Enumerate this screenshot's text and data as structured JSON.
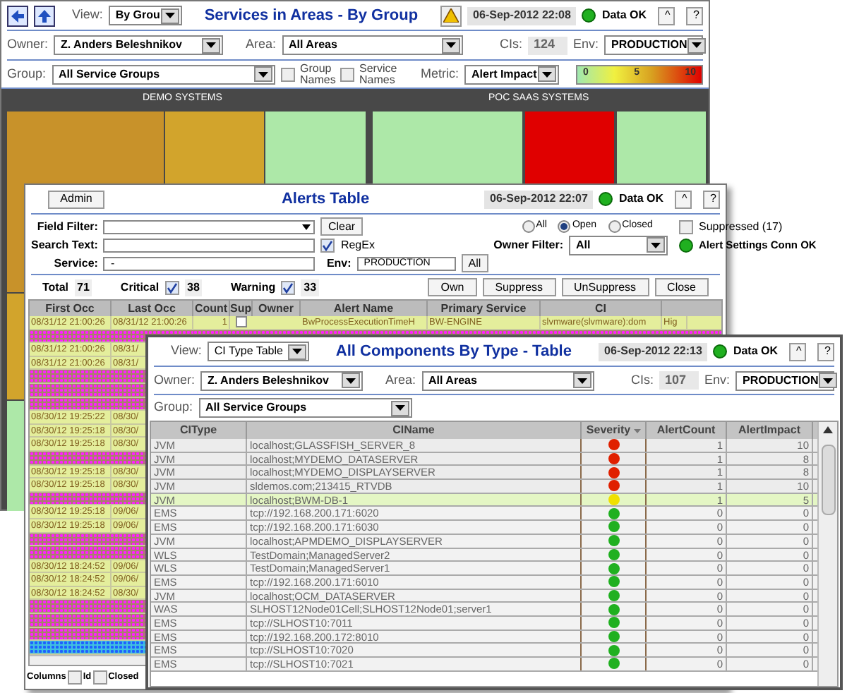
{
  "services_window": {
    "view": {
      "label": "View:",
      "value": "By Grou"
    },
    "title": "Services in Areas - By Group",
    "timestamp": "06-Sep-2012 22:08",
    "status": "Data OK",
    "buttons": [
      "^",
      "?"
    ],
    "owner": {
      "label": "Owner:",
      "value": "Z. Anders Beleshnikov"
    },
    "area": {
      "label": "Area:",
      "value": "All Areas"
    },
    "cis": {
      "label": "CIs:",
      "value": "124"
    },
    "env": {
      "label": "Env:",
      "value": "PRODUCTION"
    },
    "group": {
      "label": "Group:",
      "value": "All Service Groups"
    },
    "group_names": {
      "label": "Group Names",
      "checked": false
    },
    "service_names": {
      "label": "Service Names",
      "checked": false
    },
    "metric": {
      "label": "Metric:",
      "value": "Alert Impact"
    },
    "legend": [
      "0",
      "5",
      "10"
    ],
    "groups": [
      "DEMO SYSTEMS",
      "POC SAAS SYSTEMS"
    ],
    "tiles": [
      {
        "color": "#c8922a"
      },
      {
        "color": "#d2a42c"
      },
      {
        "color": "#ade8a8"
      },
      {
        "color": "#ade8a8"
      },
      {
        "color": "#e00000"
      },
      {
        "color": "#ade8a8"
      },
      {
        "color": "#d2a42c"
      },
      {
        "color": "#ade8a8"
      }
    ]
  },
  "alerts_window": {
    "admin": "Admin",
    "title": "Alerts Table",
    "timestamp": "06-Sep-2012 22:07",
    "status": "Data OK",
    "buttons": [
      "^",
      "?"
    ],
    "field_filter": {
      "label": "Field Filter:"
    },
    "clear": "Clear",
    "radios": [
      {
        "label": "All",
        "selected": false
      },
      {
        "label": "Open",
        "selected": true
      },
      {
        "label": "Closed",
        "selected": false
      }
    ],
    "suppressed": {
      "label": "Suppressed (17)",
      "checked": false
    },
    "search_text": {
      "label": "Search Text:"
    },
    "regex": {
      "label": "RegEx",
      "checked": true
    },
    "owner_filter": {
      "label": "Owner Filter:",
      "value": "All"
    },
    "conn_status": "Alert Settings Conn OK",
    "service": {
      "label": "Service:",
      "value": "-"
    },
    "env": {
      "label": "Env:",
      "value": "PRODUCTION"
    },
    "env_all": "All",
    "total": {
      "label": "Total",
      "value": "71"
    },
    "critical": {
      "label": "Critical",
      "checked": true,
      "value": "38"
    },
    "warning": {
      "label": "Warning",
      "checked": true,
      "value": "33"
    },
    "actions": [
      "Own",
      "Suppress",
      "UnSuppress",
      "Close"
    ],
    "columns": [
      "First Occ",
      "Last Occ",
      "Count",
      "Sup",
      "Owner",
      "Alert Name",
      "Primary Service",
      "CI"
    ],
    "rows": [
      {
        "kind": "warning",
        "selected": false,
        "first_occ": "08/31/12 21:00:26",
        "last_occ": "08/31/12 21:00:26",
        "count": "1",
        "suppressed": false,
        "alert_name": "BwProcessExecutionTimeH",
        "primary_service": "BW-ENGINE",
        "ci": "slvmware(slvmware):dom",
        "column_9": "Hig"
      },
      {
        "kind": "critical",
        "selected": false
      },
      {
        "kind": "warning",
        "selected": false,
        "first_occ": "08/31/12 21:00:26",
        "last_occ": "08/31/"
      },
      {
        "kind": "warning",
        "selected": false,
        "first_occ": "08/31/12 21:00:26",
        "last_occ": "08/31/"
      },
      {
        "kind": "critical",
        "selected": false
      },
      {
        "kind": "critical",
        "selected": false
      },
      {
        "kind": "critical",
        "selected": false
      },
      {
        "kind": "warning",
        "selected": false,
        "first_occ": "08/30/12 19:25:22",
        "last_occ": "08/30/"
      },
      {
        "kind": "warning",
        "selected": false,
        "first_occ": "08/30/12 19:25:18",
        "last_occ": "08/30/"
      },
      {
        "kind": "warning",
        "selected": false,
        "first_occ": "08/30/12 19:25:18",
        "last_occ": "08/30/"
      },
      {
        "kind": "critical",
        "selected": false
      },
      {
        "kind": "warning",
        "selected": false,
        "first_occ": "08/30/12 19:25:18",
        "last_occ": "08/30/"
      },
      {
        "kind": "warning",
        "selected": false,
        "first_occ": "08/30/12 19:25:18",
        "last_occ": "08/30/"
      },
      {
        "kind": "critical",
        "selected": false
      },
      {
        "kind": "warning",
        "selected": false,
        "first_occ": "08/30/12 19:25:18",
        "last_occ": "09/06/"
      },
      {
        "kind": "warning",
        "selected": false,
        "first_occ": "08/30/12 19:25:18",
        "last_occ": "09/06/"
      },
      {
        "kind": "critical",
        "selected": false
      },
      {
        "kind": "critical",
        "selected": false
      },
      {
        "kind": "warning",
        "selected": false,
        "first_occ": "08/30/12 18:24:52",
        "last_occ": "09/06/"
      },
      {
        "kind": "warning",
        "selected": false,
        "first_occ": "08/30/12 18:24:52",
        "last_occ": "09/06/"
      },
      {
        "kind": "warning",
        "selected": false,
        "first_occ": "08/30/12 18:24:52",
        "last_occ": "08/30/"
      },
      {
        "kind": "critical",
        "selected": false
      },
      {
        "kind": "critical",
        "selected": false
      },
      {
        "kind": "critical",
        "selected": false
      },
      {
        "kind": "critical",
        "selected": true
      }
    ],
    "footer": {
      "label": "Columns",
      "options": [
        {
          "label": "Id",
          "checked": false
        },
        {
          "label": "Closed",
          "checked": false
        }
      ]
    }
  },
  "components_window": {
    "view": {
      "label": "View:",
      "value": "CI Type Table"
    },
    "title": "All Components By Type - Table",
    "timestamp": "06-Sep-2012 22:13",
    "status": "Data OK",
    "buttons": [
      "^",
      "?"
    ],
    "owner": {
      "label": "Owner:",
      "value": "Z. Anders Beleshnikov"
    },
    "area": {
      "label": "Area:",
      "value": "All Areas"
    },
    "cis": {
      "label": "CIs:",
      "value": "107"
    },
    "env": {
      "label": "Env:",
      "value": "PRODUCTION"
    },
    "group": {
      "label": "Group:",
      "value": "All Service Groups"
    },
    "columns": [
      "CIType",
      "CIName",
      "Severity",
      "AlertCount",
      "AlertImpact"
    ],
    "rows": [
      {
        "ci_type": "JVM",
        "ci_name": "localhost;GLASSFISH_SERVER_8",
        "color": "#e02000",
        "alert_count": "1",
        "alert_impact": "10"
      },
      {
        "ci_type": "JVM",
        "ci_name": "localhost;MYDEMO_DATASERVER",
        "color": "#e02000",
        "alert_count": "1",
        "alert_impact": "8"
      },
      {
        "ci_type": "JVM",
        "ci_name": "localhost;MYDEMO_DISPLAYSERVER",
        "color": "#e02000",
        "alert_count": "1",
        "alert_impact": "8"
      },
      {
        "ci_type": "JVM",
        "ci_name": "sldemos.com;213415_RTVDB",
        "color": "#e02000",
        "alert_count": "1",
        "alert_impact": "10"
      },
      {
        "ci_type": "JVM",
        "ci_name": "localhost;BWM-DB-1",
        "color": "#f0e000",
        "alert_count": "1",
        "alert_impact": "5"
      },
      {
        "ci_type": "EMS",
        "ci_name": "tcp://192.168.200.171:6020",
        "color": "#20b020",
        "alert_count": "0",
        "alert_impact": "0"
      },
      {
        "ci_type": "EMS",
        "ci_name": "tcp://192.168.200.171:6030",
        "color": "#20b020",
        "alert_count": "0",
        "alert_impact": "0"
      },
      {
        "ci_type": "JVM",
        "ci_name": "localhost;APMDEMO_DISPLAYSERVER",
        "color": "#20b020",
        "alert_count": "0",
        "alert_impact": "0"
      },
      {
        "ci_type": "WLS",
        "ci_name": "TestDomain;ManagedServer2",
        "color": "#20b020",
        "alert_count": "0",
        "alert_impact": "0"
      },
      {
        "ci_type": "WLS",
        "ci_name": "TestDomain;ManagedServer1",
        "color": "#20b020",
        "alert_count": "0",
        "alert_impact": "0"
      },
      {
        "ci_type": "EMS",
        "ci_name": "tcp://192.168.200.171:6010",
        "color": "#20b020",
        "alert_count": "0",
        "alert_impact": "0"
      },
      {
        "ci_type": "JVM",
        "ci_name": "localhost;OCM_DATASERVER",
        "color": "#20b020",
        "alert_count": "0",
        "alert_impact": "0"
      },
      {
        "ci_type": "WAS",
        "ci_name": "SLHOST12Node01Cell;SLHOST12Node01;server1",
        "color": "#20b020",
        "alert_count": "0",
        "alert_impact": "0"
      },
      {
        "ci_type": "EMS",
        "ci_name": "tcp://SLHOST10:7011",
        "color": "#20b020",
        "alert_count": "0",
        "alert_impact": "0"
      },
      {
        "ci_type": "EMS",
        "ci_name": "tcp://192.168.200.172:8010",
        "color": "#20b020",
        "alert_count": "0",
        "alert_impact": "0"
      },
      {
        "ci_type": "EMS",
        "ci_name": "tcp://SLHOST10:7020",
        "color": "#20b020",
        "alert_count": "0",
        "alert_impact": "0"
      },
      {
        "ci_type": "EMS",
        "ci_name": "tcp://SLHOST10:7021",
        "color": "#20b020",
        "alert_count": "0",
        "alert_impact": "0"
      }
    ]
  }
}
